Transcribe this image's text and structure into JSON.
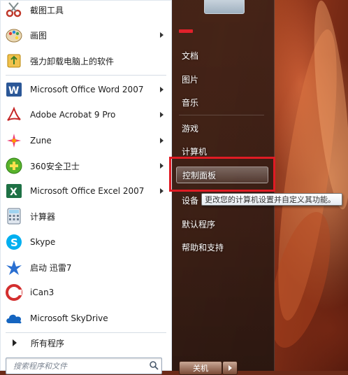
{
  "start_menu": {
    "programs": [
      {
        "label": "截图工具",
        "icon": "scissors-icon",
        "has_arrow": false
      },
      {
        "label": "画图",
        "icon": "paint-palette-icon",
        "has_arrow": true
      },
      {
        "label": "强力卸载电脑上的软件",
        "icon": "uninstall-recycle-icon",
        "has_arrow": false
      },
      {
        "label": "Microsoft Office Word 2007",
        "icon": "word-icon",
        "has_arrow": true
      },
      {
        "label": "Adobe Acrobat 9 Pro",
        "icon": "acrobat-icon",
        "has_arrow": true
      },
      {
        "label": "Zune",
        "icon": "zune-icon",
        "has_arrow": true
      },
      {
        "label": "360安全卫士",
        "icon": "shield-360-icon",
        "has_arrow": true
      },
      {
        "label": "Microsoft Office Excel 2007",
        "icon": "excel-icon",
        "has_arrow": true
      },
      {
        "label": "计算器",
        "icon": "calculator-icon",
        "has_arrow": false
      },
      {
        "label": "Skype",
        "icon": "skype-icon",
        "has_arrow": false
      },
      {
        "label": "启动 迅雷7",
        "icon": "thunder-icon",
        "has_arrow": false
      },
      {
        "label": "iCan3",
        "icon": "ican-icon",
        "has_arrow": false
      },
      {
        "label": "Microsoft SkyDrive",
        "icon": "skydrive-cloud-icon",
        "has_arrow": false
      }
    ],
    "all_programs": "所有程序",
    "search": {
      "placeholder": "搜索程序和文件"
    },
    "right_panel": {
      "items": [
        "文档",
        "图片",
        "音乐",
        "游戏",
        "计算机",
        "控制面板",
        "设备",
        "默认程序",
        "帮助和支持"
      ],
      "highlighted_item": "控制面板",
      "tooltip": "更改您的计算机设置并自定义其功能。"
    },
    "shutdown_label": "关机",
    "colors": {
      "highlight_box": "#e01b24",
      "panel_dark": "#3c2016",
      "left_panel": "#ffffff"
    }
  }
}
